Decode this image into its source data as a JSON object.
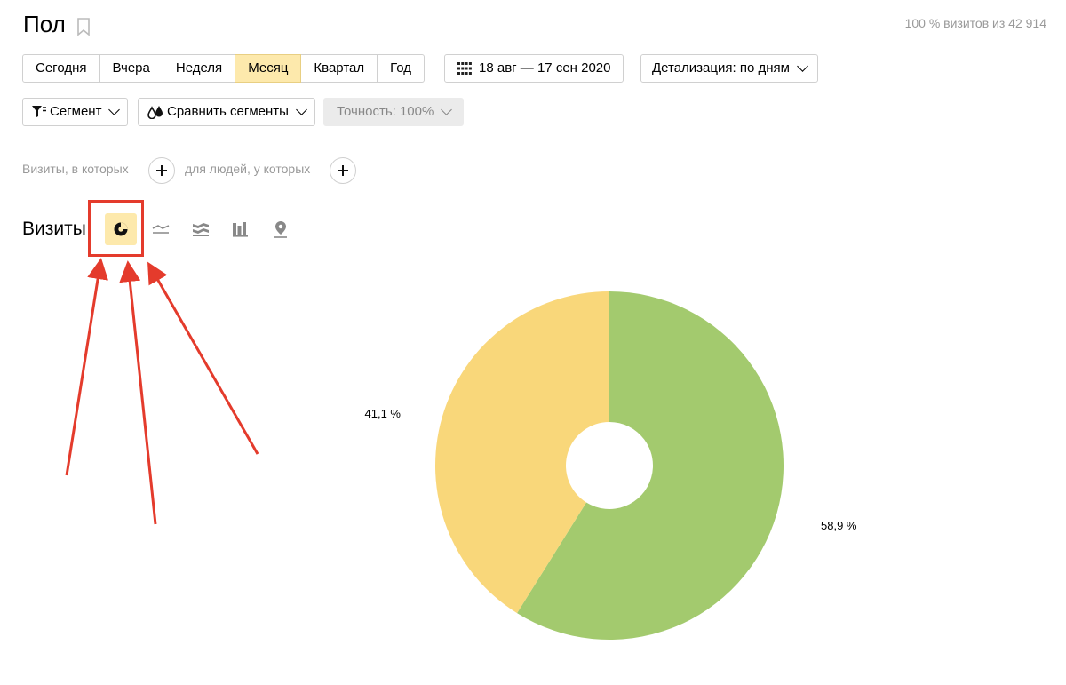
{
  "header": {
    "title": "Пол",
    "visits_info": "100 % визитов из 42 914"
  },
  "period": {
    "options": [
      "Сегодня",
      "Вчера",
      "Неделя",
      "Месяц",
      "Квартал",
      "Год"
    ],
    "selected": "Месяц"
  },
  "date_range": {
    "label": "18 авг — 17 сен 2020"
  },
  "detail": {
    "label": "Детализация: по дням"
  },
  "segment": {
    "label": "Сегмент"
  },
  "compare": {
    "label": "Сравнить сегменты"
  },
  "accuracy": {
    "label": "Точность: 100%"
  },
  "filters": {
    "visits_label": "Визиты, в которых",
    "people_label": "для людей, у которых"
  },
  "chart_section": {
    "title": "Визиты",
    "types": [
      "pie-chart-icon",
      "line-chart-icon",
      "area-chart-icon",
      "bar-chart-icon",
      "map-icon"
    ],
    "selected_type": "pie-chart-icon"
  },
  "colors": {
    "accent": "#fde9ac",
    "highlight": "#e43b2c",
    "series_female": "#f9d77a",
    "series_male": "#a3ca6e"
  },
  "chart_data": {
    "type": "pie",
    "donut": true,
    "categories": [
      "",
      ""
    ],
    "values": [
      58.9,
      41.1
    ],
    "labels": [
      "58,9 %",
      "41,1 %"
    ],
    "colors": [
      "#a3ca6e",
      "#f9d77a"
    ]
  }
}
